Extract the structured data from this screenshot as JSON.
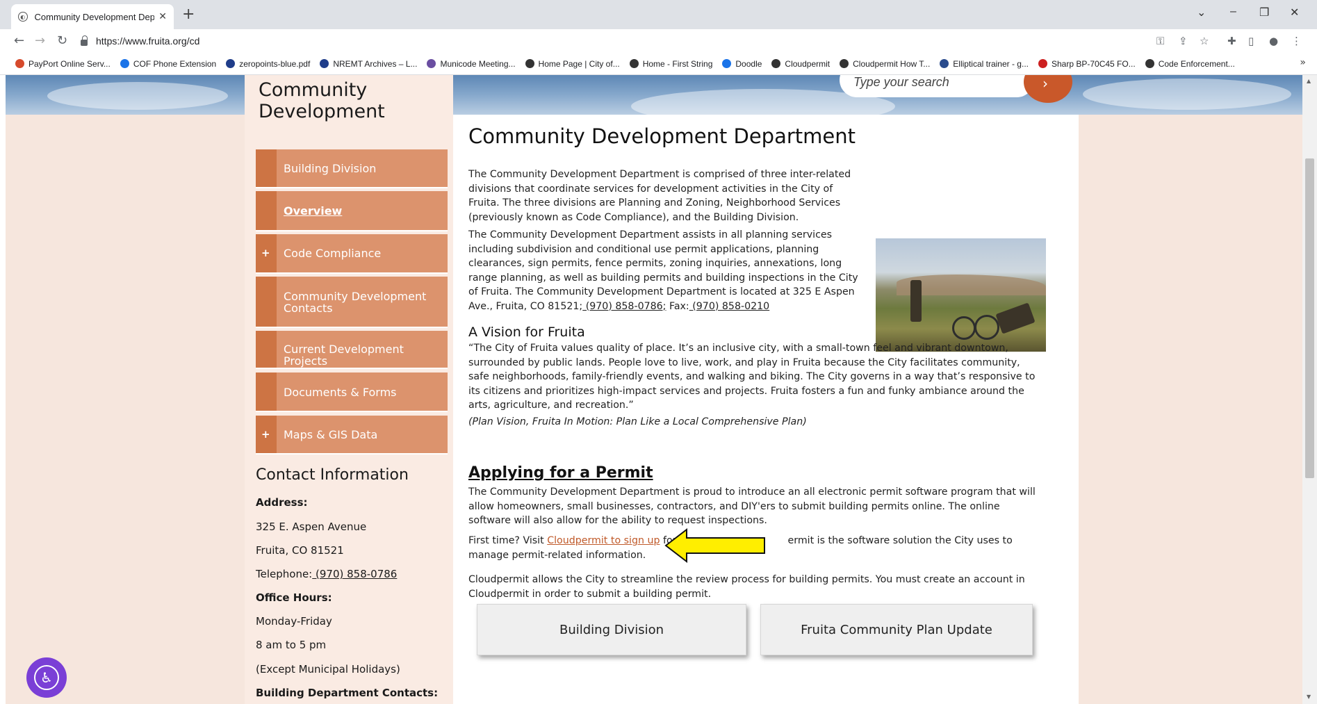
{
  "browser": {
    "tab_title": "Community Development Depa",
    "new_tab": "+",
    "url": "https://www.fruita.org/cd",
    "win_min": "–",
    "win_restore": "❐",
    "win_close": "✕",
    "tab_list": "⌄"
  },
  "bookmarks": [
    {
      "label": "PayPort Online Serv...",
      "color": "#d64a2c"
    },
    {
      "label": "COF Phone Extension",
      "color": "#1a73e8"
    },
    {
      "label": "zeropoints-blue.pdf",
      "color": "#1f3d8a"
    },
    {
      "label": "NREMT Archives – L...",
      "color": "#1f3d8a"
    },
    {
      "label": "Municode Meeting...",
      "color": "#6a4ea1"
    },
    {
      "label": "Home Page | City of...",
      "color": "#333333"
    },
    {
      "label": "Home - First String",
      "color": "#333333"
    },
    {
      "label": "Doodle",
      "color": "#1a73e8"
    },
    {
      "label": "Cloudpermit",
      "color": "#333333"
    },
    {
      "label": "Cloudpermit How T...",
      "color": "#333333"
    },
    {
      "label": "Elliptical trainer - g...",
      "color": "#2a4b8d"
    },
    {
      "label": "Sharp BP-70C45 FO...",
      "color": "#cc1f1f"
    },
    {
      "label": "Code Enforcement...",
      "color": "#333333"
    }
  ],
  "bookmarks_more": "»",
  "header": {
    "search_placeholder": "Type your search"
  },
  "sidebar": {
    "title_line1": "Community",
    "title_line2": "Development",
    "nav": [
      {
        "label": "Building Division",
        "plus": ""
      },
      {
        "label": "Overview",
        "plus": ""
      },
      {
        "label": "Code Compliance",
        "plus": "+"
      },
      {
        "label": "Community Development Contacts",
        "plus": ""
      },
      {
        "label": "Current Development Projects",
        "plus": ""
      },
      {
        "label": "Documents & Forms",
        "plus": ""
      },
      {
        "label": "Maps & GIS Data",
        "plus": "+"
      }
    ],
    "contact_title": "Contact Information",
    "address_label": "Address:",
    "address_line1": "325 E. Aspen Avenue",
    "address_line2": "Fruita, CO 81521",
    "telephone_label": "Telephone:",
    "telephone": " (970) 858-0786",
    "hours_label": "Office Hours:",
    "hours_days": "Monday-Friday",
    "hours_time": "8 am to 5 pm",
    "hours_note": "(Except Municipal Holidays)",
    "building_contacts": "Building Department Contacts:"
  },
  "main": {
    "title": "Community Development Department",
    "p1": "The Community Development Department is comprised of three inter-related divisions that coordinate services for development activities in the City of Fruita. The three divisions are Planning and Zoning, Neighborhood Services (previously known as Code Compliance), and the Building Division.",
    "p2_text": "The Community Development Department assists in all planning services including subdivision and conditional use permit applications, planning clearances, sign permits, fence permits, zoning inquiries, annexations, long range planning, as well as building permits and building inspections in the City of Fruita. The Community Development Department is located at 325 E Aspen Ave., Fruita, CO 81521;",
    "p2_phone": " (970) 858-0786;",
    "p2_fax_label": " Fax:",
    "p2_fax": " (970) 858-0210",
    "vision_title": "A Vision for Fruita",
    "vision_quote": "“The City of Fruita values quality of place. It’s an inclusive city, with a small-town feel and vibrant downtown, surrounded by public lands. People love to live, work, and play in Fruita because the City facilitates community, safe neighborhoods, family-friendly events, and walking and biking. The City governs in a way that’s responsive to its citizens and prioritizes high-impact services and projects. Fruita fosters a fun and funky ambiance around the arts, agriculture, and recreation.”",
    "vision_source": "(Plan Vision, Fruita In Motion: Plan Like a Local Comprehensive Plan)",
    "permit_title": "Applying for a Permit",
    "permit_p1": "The Community Development Department is proud to introduce an all electronic permit software program that will allow homeowners, small businesses, contractors, and DIY'ers to submit building permits online. The online software will also allow for the ability to request inspections.",
    "permit_p2_a": "First time? Visit ",
    "permit_p2_link": "Cloudpermit to sign up",
    "permit_p2_b": " for",
    "permit_p2_c": "ermit is the software solution the City uses to manage permit-related information.",
    "permit_p3": "Cloudpermit allows the City to streamline the review process for building permits. You must create an account in Cloudpermit in order to submit a building permit.",
    "btn_building": "Building Division",
    "btn_plan": "Fruita Community Plan Update"
  },
  "colors": {
    "nav_bg": "#dc936d",
    "nav_accent": "#cd7444",
    "link_orange": "#c05a2a",
    "arrow_yellow": "#ffee00",
    "accessibility_purple": "#7a3fd6"
  }
}
